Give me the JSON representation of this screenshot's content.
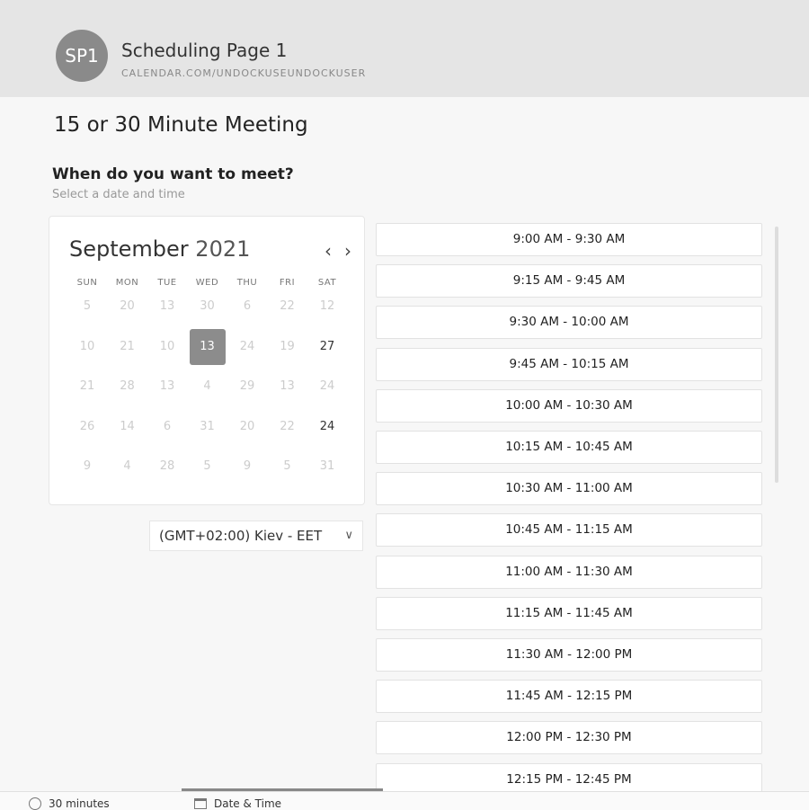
{
  "header": {
    "avatar_initials": "SP1",
    "page_name": "Scheduling Page 1",
    "page_url": "CALENDAR.COM/UNDOCKUSEUNDOCKUSER"
  },
  "meeting": {
    "title": "15 or 30 Minute Meeting",
    "question": "When do you want to meet?",
    "instruction": "Select a date and time"
  },
  "calendar": {
    "month": "September",
    "year": "2021",
    "weekdays": [
      "SUN",
      "MON",
      "TUE",
      "WED",
      "THU",
      "FRI",
      "SAT"
    ],
    "weeks": [
      [
        "5",
        "20",
        "13",
        "30",
        "6",
        "22",
        "12"
      ],
      [
        "10",
        "21",
        "10",
        "13",
        "24",
        "19",
        "27"
      ],
      [
        "21",
        "28",
        "13",
        "4",
        "29",
        "13",
        "24"
      ],
      [
        "26",
        "14",
        "6",
        "31",
        "20",
        "22",
        "24"
      ],
      [
        "9",
        "4",
        "28",
        "5",
        "9",
        "5",
        "31"
      ]
    ],
    "selected_day": "13",
    "available_days": [
      "27",
      "24"
    ]
  },
  "timezone": {
    "label": "(GMT+02:00) Kiev - EET"
  },
  "time_slots": [
    "9:00 AM - 9:30 AM",
    "9:15 AM - 9:45 AM",
    "9:30 AM - 10:00 AM",
    "9:45 AM - 10:15 AM",
    "10:00 AM - 10:30 AM",
    "10:15 AM - 10:45 AM",
    "10:30 AM - 11:00 AM",
    "10:45 AM - 11:15 AM",
    "11:00 AM - 11:30 AM",
    "11:15 AM - 11:45 AM",
    "11:30 AM - 12:00 PM",
    "11:45 AM - 12:15 PM",
    "12:00 PM - 12:30 PM",
    "12:15 PM - 12:45 PM"
  ],
  "footer": {
    "duration": "30 minutes",
    "step": "Date & Time"
  }
}
